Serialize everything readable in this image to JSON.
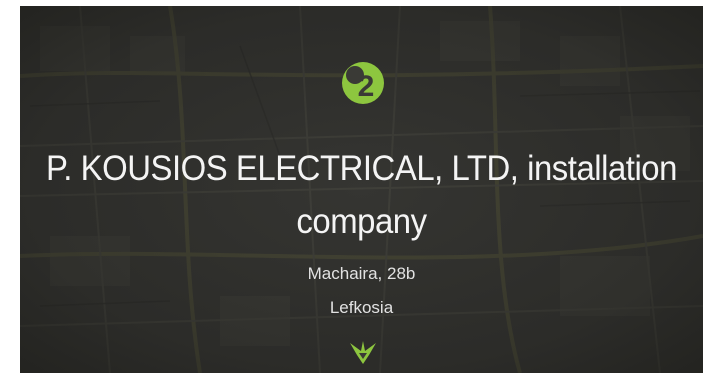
{
  "card": {
    "badge_text": "2",
    "title_line1": "P. KOUSIOS ELECTRICAL, LTD, installation",
    "title_line2": "company",
    "address_line1": "Machaira, 28b",
    "address_line2": "Lefkosia"
  },
  "colors": {
    "accent": "#8dc63f",
    "background": "#3a3a36",
    "text": "#f4f4f4"
  },
  "icons": {
    "badge": "category-number-badge-icon",
    "pin": "bird-marker-icon"
  }
}
